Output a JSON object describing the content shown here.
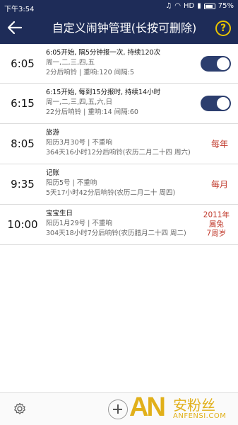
{
  "status": {
    "time": "下午3:54",
    "network": "HD",
    "battery": "75%"
  },
  "header": {
    "title": "自定义闹钟管理(长按可删除)",
    "help": "?"
  },
  "alarms": [
    {
      "time": "6:05",
      "line1": "6:05开始, 隔5分钟报一次, 持续120次",
      "line2": "周一,二,三,四,五",
      "line3": "2分后响铃 | 重响:120  间隔:5",
      "enabled": true
    },
    {
      "time": "6:15",
      "line1": "6:15开始, 每到15分报时, 持续14小时",
      "line2": "周一,二,三,四,五,六,日",
      "line3": "22分后响铃 | 重响:14  间隔:60",
      "enabled": true
    },
    {
      "time": "8:05",
      "line1": "旅游",
      "line2": "阳历3月30号 | 不重响",
      "line3": "364天16小时12分后响铃(农历二月二十四 周六)",
      "repeat": "每年"
    },
    {
      "time": "9:35",
      "line1": "记账",
      "line2": "阳历5号 | 不重响",
      "line3": "5天17小时42分后响铃(农历二月二十 周四)",
      "repeat": "每月"
    },
    {
      "time": "10:00",
      "line1": "宝宝生日",
      "line2": "阳历1月29号 | 不重响",
      "line3": "304天18小时7分后响铃(农历腊月二十四 周二)",
      "repeat_lines": [
        "2011年",
        "属兔",
        "7周岁"
      ]
    }
  ],
  "watermark": {
    "logo": "AN",
    "cn": "安粉丝",
    "en": "ANFENSI.COM"
  },
  "colors": {
    "header": "#1e2c58",
    "toggle_on": "#2c3e6e",
    "repeat_text": "#c0392b",
    "help_icon": "#e8c400",
    "watermark": "#e1b01a"
  }
}
